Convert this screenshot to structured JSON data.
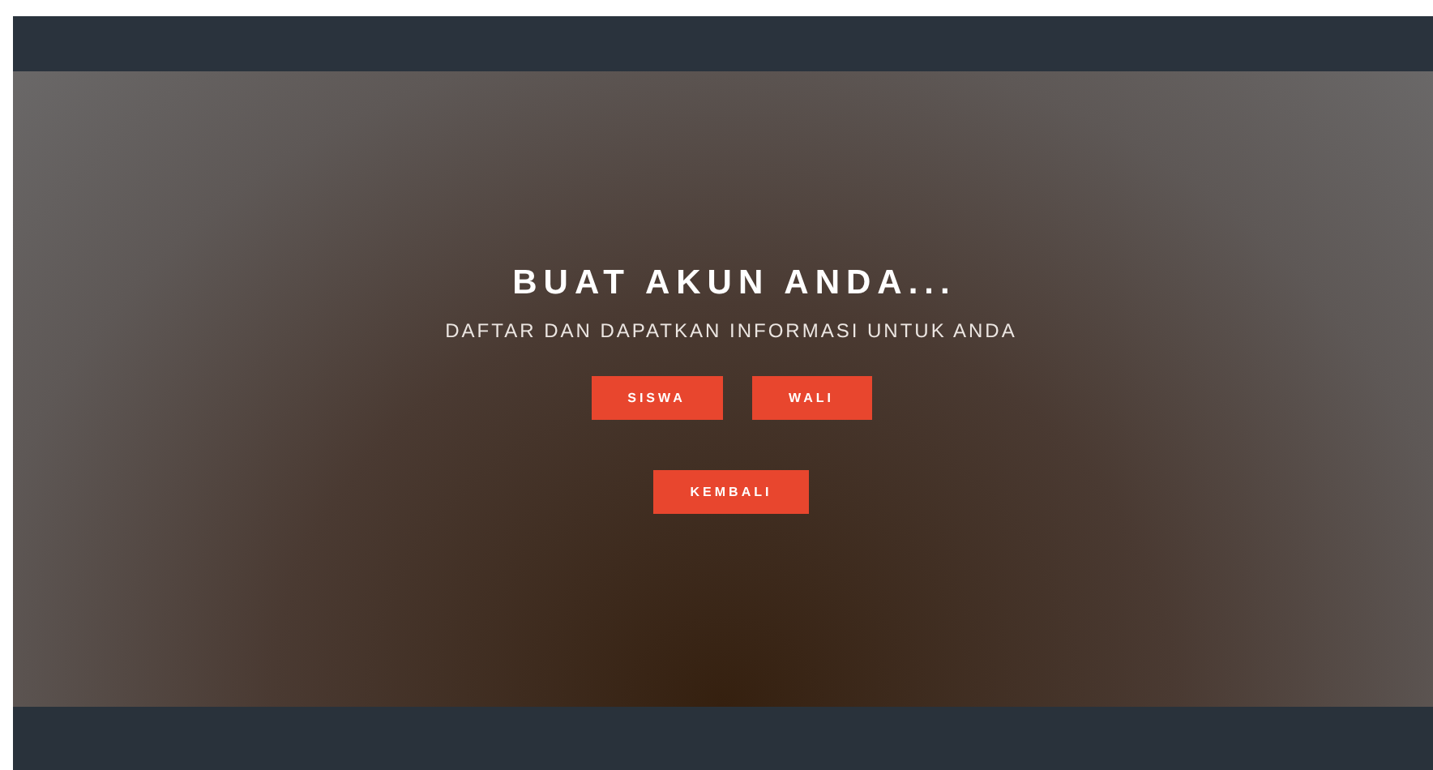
{
  "hero": {
    "title": "BUAT AKUN ANDA...",
    "subtitle": "DAFTAR DAN DAPATKAN INFORMASI UNTUK ANDA",
    "button_rows": [
      [
        "SISWA",
        "WALI"
      ],
      [
        "KEMBALI"
      ]
    ]
  }
}
